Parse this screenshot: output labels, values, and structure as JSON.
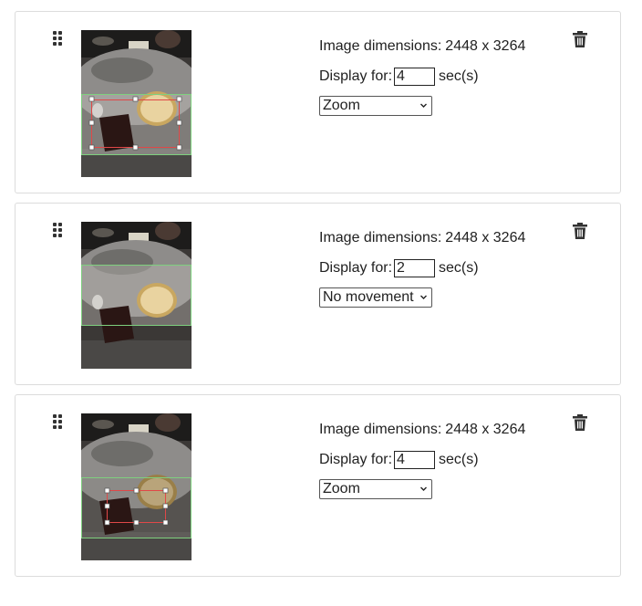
{
  "items": [
    {
      "dimensions_label": "Image dimensions:",
      "dimensions_value": "2448 x 3264",
      "display_label": "Display for:",
      "display_seconds": "4",
      "seconds_unit": "sec(s)",
      "movement_selected": "Zoom"
    },
    {
      "dimensions_label": "Image dimensions:",
      "dimensions_value": "2448 x 3264",
      "display_label": "Display for:",
      "display_seconds": "2",
      "seconds_unit": "sec(s)",
      "movement_selected": "No movement"
    },
    {
      "dimensions_label": "Image dimensions:",
      "dimensions_value": "2448 x 3264",
      "display_label": "Display for:",
      "display_seconds": "4",
      "seconds_unit": "sec(s)",
      "movement_selected": "Zoom"
    }
  ],
  "icons": {
    "drag": "drag-handle-icon",
    "delete": "trash-icon",
    "dropdown": "chevron-down-icon"
  },
  "colors": {
    "crop_frame": "#7ed07e",
    "zoom_frame": "#e04848",
    "handle": "#ffffff"
  }
}
